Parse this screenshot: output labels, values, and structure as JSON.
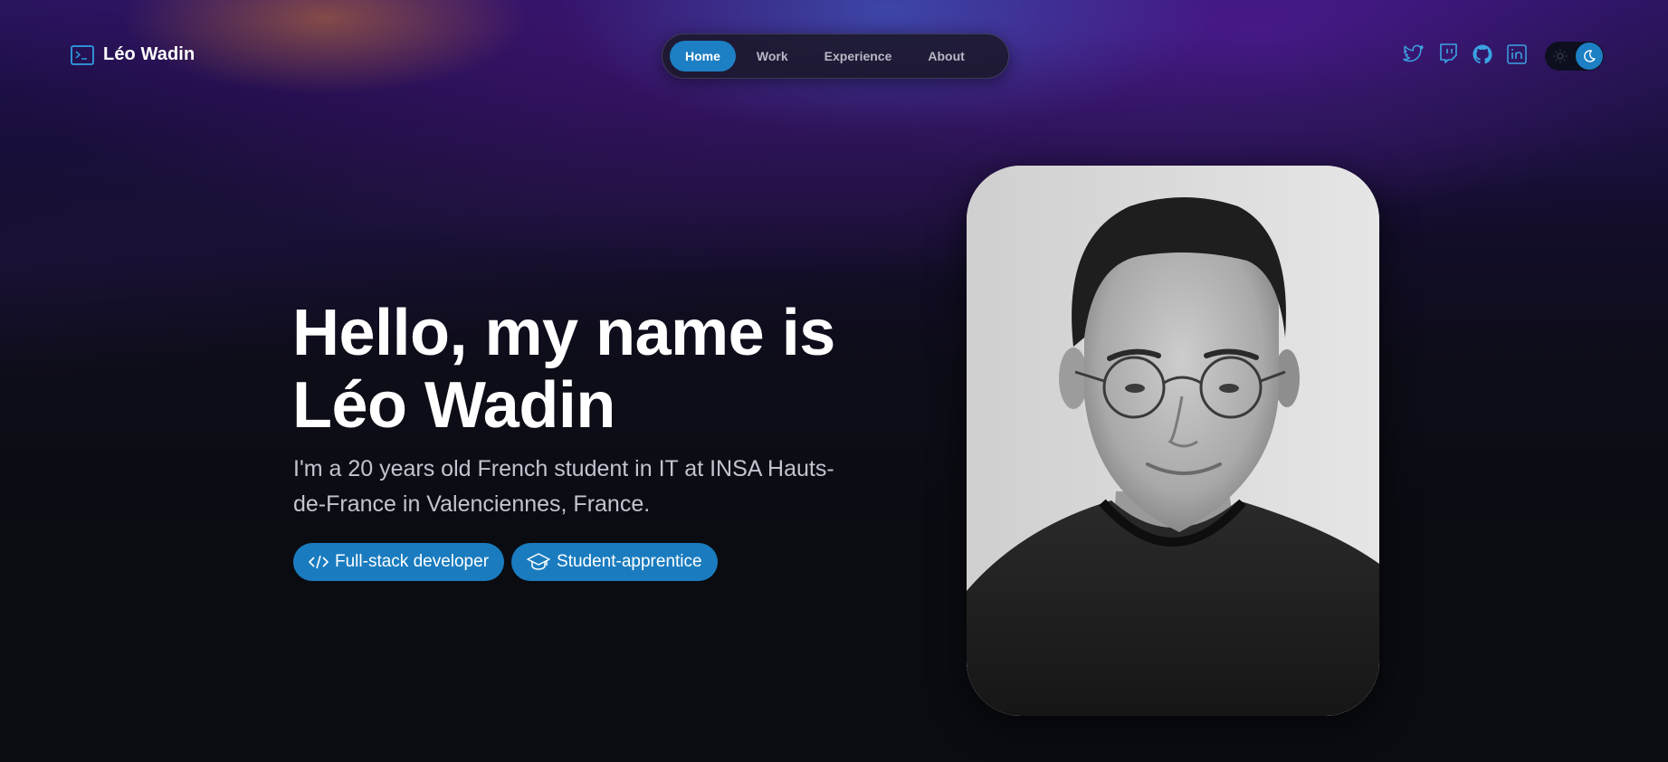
{
  "header": {
    "brand_name": "Léo Wadin",
    "brand_icon": "terminal-icon"
  },
  "nav": {
    "items": [
      {
        "label": "Home",
        "active": true
      },
      {
        "label": "Work",
        "active": false
      },
      {
        "label": "Experience",
        "active": false
      },
      {
        "label": "About",
        "active": false
      }
    ]
  },
  "socials": [
    {
      "name": "twitter-icon"
    },
    {
      "name": "twitch-icon"
    },
    {
      "name": "github-icon"
    },
    {
      "name": "linkedin-icon"
    }
  ],
  "theme_toggle": {
    "mode": "dark",
    "icons": [
      "sun-icon",
      "moon-icon"
    ]
  },
  "hero": {
    "title_line1": "Hello, my name is",
    "title_line2": "Léo Wadin",
    "subtitle": "I'm a 20 years old French student in IT at INSA Hauts-de-France in Valenciennes, France.",
    "tags": [
      {
        "label": "Full-stack developer",
        "icon": "code-icon"
      },
      {
        "label": "Student-apprentice",
        "icon": "graduation-cap-icon"
      }
    ]
  },
  "portrait": {
    "description_icon": "profile-photo"
  },
  "colors": {
    "accent": "#1d7fc4",
    "background": "#0a0c12",
    "text_muted": "#c3c4cf",
    "icon_blue": "#3aa3e3"
  }
}
